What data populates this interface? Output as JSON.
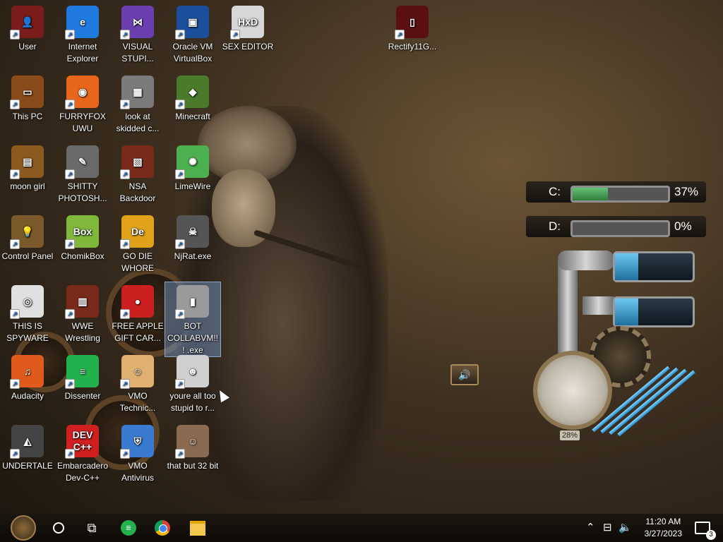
{
  "desktop": {
    "icons": [
      {
        "label": "User",
        "glyph": "👤",
        "color": "#7a1c1c"
      },
      {
        "label": "Internet Explorer",
        "glyph": "e",
        "color": "#1f7ae0"
      },
      {
        "label": "VISUAL STUPI...",
        "glyph": "⋈",
        "color": "#6c3fb0"
      },
      {
        "label": "Oracle VM VirtualBox",
        "glyph": "▣",
        "color": "#1b4e9b"
      },
      {
        "label": "SEX EDITOR",
        "glyph": "HxD",
        "color": "#d7d7d7"
      },
      {
        "label": "Rectify11G...",
        "glyph": "▯",
        "color": "#5a1010"
      },
      {
        "label": "This PC",
        "glyph": "▭",
        "color": "#8a4b1b"
      },
      {
        "label": "FURRYFOX UWU",
        "glyph": "◉",
        "color": "#e8661b"
      },
      {
        "label": "look at skidded c...",
        "glyph": "▦",
        "color": "#7b7b7b"
      },
      {
        "label": "Minecraft",
        "glyph": "◆",
        "color": "#4a7a2a"
      },
      {
        "label": "moon girl",
        "glyph": "▤",
        "color": "#8b5a1e"
      },
      {
        "label": "SHITTY PHOTOSH...",
        "glyph": "✎",
        "color": "#6a6a6a"
      },
      {
        "label": "NSA Backdoor",
        "glyph": "▧",
        "color": "#7a2a1a"
      },
      {
        "label": "LimeWire",
        "glyph": "✺",
        "color": "#4caf50"
      },
      {
        "label": "Control Panel",
        "glyph": "💡",
        "color": "#7a5a2a"
      },
      {
        "label": "ChomikBox",
        "glyph": "Box",
        "color": "#7fb83a"
      },
      {
        "label": "GO DIE WHORE",
        "glyph": "De",
        "color": "#e0a21b"
      },
      {
        "label": "NjRat.exe",
        "glyph": "☠",
        "color": "#555"
      },
      {
        "label": "THIS IS SPYWARE",
        "glyph": "◎",
        "color": "#e0e0e0"
      },
      {
        "label": "WWE Wrestling",
        "glyph": "▥",
        "color": "#7a2a1a"
      },
      {
        "label": "FREE APPLE GIFT CAR...",
        "glyph": "●",
        "color": "#cc1f1f"
      },
      {
        "label": "BOT COLLABVM!!! .exe",
        "glyph": "▮",
        "color": "#9a9a9a"
      },
      {
        "label": "Audacity",
        "glyph": "♫",
        "color": "#e05a1b"
      },
      {
        "label": "Dissenter",
        "glyph": "≡",
        "color": "#22b14c"
      },
      {
        "label": "VMO Technic...",
        "glyph": "☺",
        "color": "#e0b070"
      },
      {
        "label": "youre all too stupid to r...",
        "glyph": "☻",
        "color": "#d0d0d0"
      },
      {
        "label": "UNDERTALE",
        "glyph": "◭",
        "color": "#444"
      },
      {
        "label": "Embarcadero Dev-C++",
        "glyph": "DEV C++",
        "color": "#d01f1f"
      },
      {
        "label": "VMO Antivirus",
        "glyph": "⛨",
        "color": "#3a7ad0"
      },
      {
        "label": "that but 32 bit",
        "glyph": "☺",
        "color": "#8a6a50"
      }
    ]
  },
  "widget": {
    "drive_c": {
      "letter": "C:",
      "percent_text": "37%",
      "fill": 0.37
    },
    "drive_d": {
      "letter": "D:",
      "percent_text": "0%",
      "fill": 0.0
    },
    "tube1_fill": 0.3,
    "tube2_fill": 0.3,
    "gauge_text": "28%"
  },
  "taskbar": {
    "time": "11:20 AM",
    "date": "3/27/2023",
    "notification_count": "3"
  }
}
